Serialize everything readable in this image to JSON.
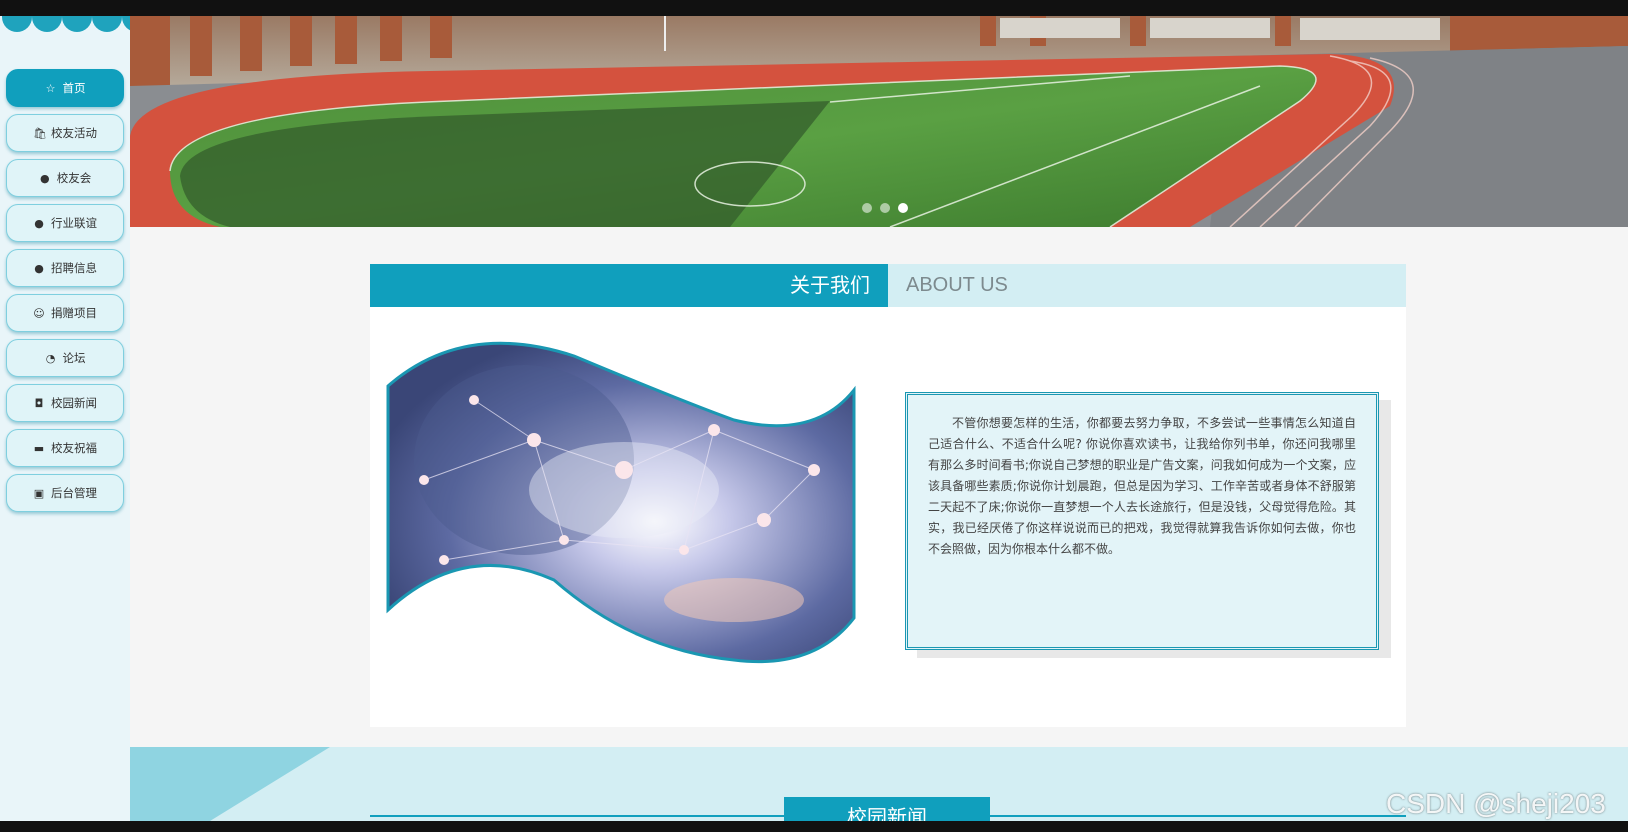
{
  "sidebar": {
    "items": [
      {
        "label": "首页",
        "icon": "star-icon",
        "glyph": "☆",
        "active": true
      },
      {
        "label": "校友活动",
        "icon": "bag-icon",
        "glyph": "🛍",
        "active": false
      },
      {
        "label": "校友会",
        "icon": "exclamation-icon",
        "glyph": "●",
        "active": false
      },
      {
        "label": "行业联谊",
        "icon": "question-icon",
        "glyph": "●",
        "active": false
      },
      {
        "label": "招聘信息",
        "icon": "info-icon",
        "glyph": "●",
        "active": false
      },
      {
        "label": "捐赠项目",
        "icon": "smile-icon",
        "glyph": "☺",
        "active": false
      },
      {
        "label": "论坛",
        "icon": "chat-icon",
        "glyph": "◔",
        "active": false
      },
      {
        "label": "校园新闻",
        "icon": "camera-icon",
        "glyph": "◘",
        "active": false
      },
      {
        "label": "校友祝福",
        "icon": "car-icon",
        "glyph": "▬",
        "active": false
      },
      {
        "label": "后台管理",
        "icon": "clipboard-icon",
        "glyph": "▣",
        "active": false
      }
    ]
  },
  "banner": {
    "slide_count": 3,
    "active_slide": 3
  },
  "about": {
    "title": "关于我们",
    "subtitle": "ABOUT US",
    "text": "不管你想要怎样的生活，你都要去努力争取，不多尝试一些事情怎么知道自己适合什么、不适合什么呢? 你说你喜欢读书，让我给你列书单，你还问我哪里有那么多时间看书;你说自己梦想的职业是广告文案，问我如何成为一个文案，应该具备哪些素质;你说你计划晨跑，但总是因为学习、工作辛苦或者身体不舒服第二天起不了床;你说你一直梦想一个人去长途旅行，但是没钱，父母觉得危险。其实，我已经厌倦了你这样说说而已的把戏，我觉得就算我告诉你如何去做，你也不会照做，因为你根本什么都不做。"
  },
  "news": {
    "title": "校园新闻"
  },
  "watermark": "CSDN @sheji203",
  "colors": {
    "accent": "#109fbd",
    "light_accent": "#d3eef3"
  }
}
